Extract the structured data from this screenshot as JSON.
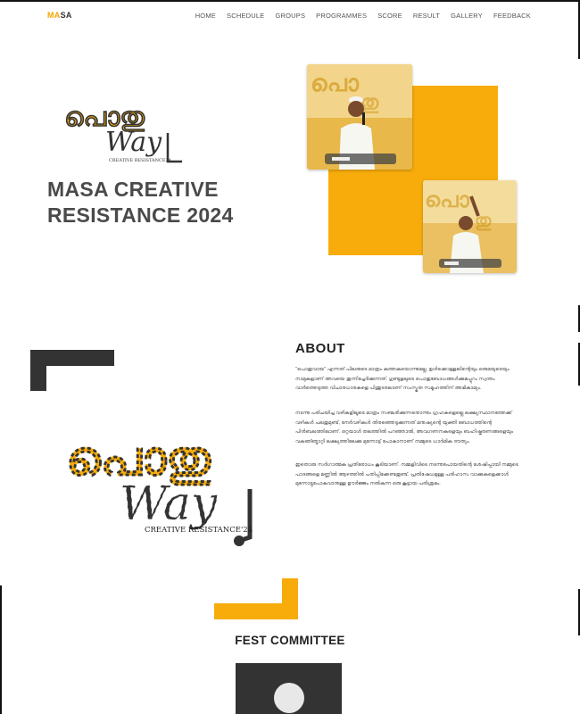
{
  "nav": {
    "brand_accent": "MA",
    "brand_rest": "SA",
    "links": [
      "HOME",
      "SCHEDULE",
      "GROUPS",
      "PROGRAMMES",
      "SCORE",
      "RESULT",
      "GALLERY",
      "FEEDBACK"
    ]
  },
  "hero": {
    "logo_text_top": "പൊതു",
    "logo_text_bottom": "Way",
    "logo_caption": "CREATIVE RESISTANCE24",
    "title_line1": "MASA CREATIVE",
    "title_line2": "RESISTANCE 2024"
  },
  "about": {
    "logo_text_top": "പൊതു",
    "logo_text_bottom": "Way",
    "logo_caption": "CREATIVE RESISTANCE'24",
    "title": "ABOUT",
    "paragraphs": [
      "\"പൊതുവായ\" എന്നത് പിലരുടെ മാത്രം കുത്തകയൊന്നുമല്ല. ഉൾക്കൊള്ളലിന്റെയും ഒരുമയുടെയും നാമുകളാണ് അവയെ തുന്നിച്ചേർക്കുന്നത്. ഗുണ്ടുളലുടെ പൊതുബോധങ്ങൾക്കുമപ്പുറം സ്വന്തം വാർത്തെടുത്ത വിചാരധാരകളെ പിന്തുടരലാണ് സംസ്കൃത സമൂഹത്തിന് അഭികാമ്യം.",
      "നടന്നു പരിചയിച്ച വഴികളിലൂടെ മാത്രം സഞ്ചരിക്കുന്നതൊന്നും ഗ്രഹകളെല്ലെ ലക്ഷ്യസ്ഥാനത്തേക്ക് വഴികൾ പലതുമുണ്ട്, നേർവഴികൾ തിരഞ്ഞെടുക്കുന്നത് മനുഷ്യന്റെ യുക്തി ബോധത്തിന്റെ പിൻബലത്തിലാണ്. ഒറ്റയാൾ തലത്തിൽ പറഞ്ഞാൽ, അവഗണനകളെയും ബഹിഷ്കരണങ്ങളെയും വകഞ്ഞ്മാറ്റി ലക്ഷ്യത്തിലേക്കു മുന്നോട്ട് പോകാനാണ് നമ്മുടെ ധാർമിക ദൗത്യം.",
      "ഇതൊരു സർഗാത്മക പ്രതിരോധം കൂടിയാണ്. നമ്മളിവിടെ നടന്നുപോയതിന്റെ ശേഷിപ്പായി നമ്മുടെ പാദങ്ങളെ മണ്ണിൽ ആഴത്തിൽ പതിപ്പിക്കേണ്ടതുണ്ട്. പ്രതിഷേധമുള്ള പരിഹാസ വാക്കുകളെക്കാൾ മുന്നോട്ടുപോകുവാനുള്ള ഊർജ്ജം നൽകുന്ന ഒരു കൂട്ടായ പരിശ്രമം."
    ]
  },
  "fest": {
    "title": "FEST COMMITTEE"
  },
  "colors": {
    "accent": "#f7ac0b",
    "dark": "#333333",
    "title": "#4a4a4a"
  }
}
